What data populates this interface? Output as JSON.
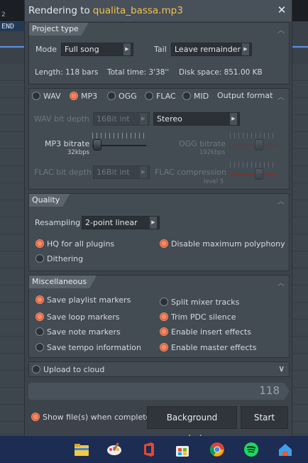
{
  "background": {
    "marker_number": "2",
    "end_label": "END"
  },
  "dialog": {
    "title_prefix": "Rendering to",
    "filename": "qualita_bassa.mp3",
    "close_glyph": "✕"
  },
  "project_type": {
    "header": "Project type",
    "mode_label": "Mode",
    "mode_value": "Full song",
    "tail_label": "Tail",
    "tail_value": "Leave remainder",
    "length": "Length: 118 bars",
    "total_time": "Total time: 3'38''",
    "disk_space": "Disk space: 851.00 KB"
  },
  "output_format": {
    "header": "Output format",
    "formats": [
      {
        "label": "WAV",
        "selected": false
      },
      {
        "label": "MP3",
        "selected": true
      },
      {
        "label": "OGG",
        "selected": false
      },
      {
        "label": "FLAC",
        "selected": false
      },
      {
        "label": "MID",
        "selected": false
      }
    ],
    "wav_bit_depth_label": "WAV bit depth",
    "wav_bit_depth_value": "16Bit int",
    "channels_value": "Stereo",
    "mp3_bitrate_label": "MP3 bitrate",
    "mp3_bitrate_value": "32kbps",
    "ogg_bitrate_label": "OGG bitrate",
    "ogg_bitrate_value": "192kbps",
    "flac_bit_depth_label": "FLAC bit depth",
    "flac_bit_depth_value": "16Bit int",
    "flac_compression_label": "FLAC compression",
    "flac_compression_value": "level 5"
  },
  "quality": {
    "header": "Quality",
    "resampling_label": "Resampling",
    "resampling_value": "2-point linear",
    "hq_plugins": {
      "label": "HQ for all plugins",
      "checked": true
    },
    "disable_polyphony": {
      "label": "Disable maximum polyphony",
      "checked": true
    },
    "dithering": {
      "label": "Dithering",
      "checked": false
    }
  },
  "misc": {
    "header": "Miscellaneous",
    "left": [
      {
        "label": "Save playlist markers",
        "checked": true
      },
      {
        "label": "Save loop markers",
        "checked": true
      },
      {
        "label": "Save note markers",
        "checked": false
      },
      {
        "label": "Save tempo information",
        "checked": false
      }
    ],
    "right": [
      {
        "label": "Split mixer tracks",
        "checked": false
      },
      {
        "label": "Trim PDC silence",
        "checked": true
      },
      {
        "label": "Enable insert effects",
        "checked": true
      },
      {
        "label": "Enable master effects",
        "checked": true
      }
    ]
  },
  "upload": {
    "label": "Upload to cloud",
    "checked": false
  },
  "progress": {
    "value": "118"
  },
  "footer": {
    "show_files_label": "Show file(s) when complete",
    "show_files_checked": true,
    "background_button": "Background rendering",
    "start_button": "Start"
  },
  "taskbar": {
    "icons": [
      "file-explorer-icon",
      "paint-icon",
      "office-icon",
      "store-icon",
      "chrome-icon",
      "spotify-icon",
      "home-icon"
    ]
  },
  "colors": {
    "accent_orange": "#f07850",
    "title_filename": "#f2c14e",
    "taskbar": "#1c2c52"
  }
}
